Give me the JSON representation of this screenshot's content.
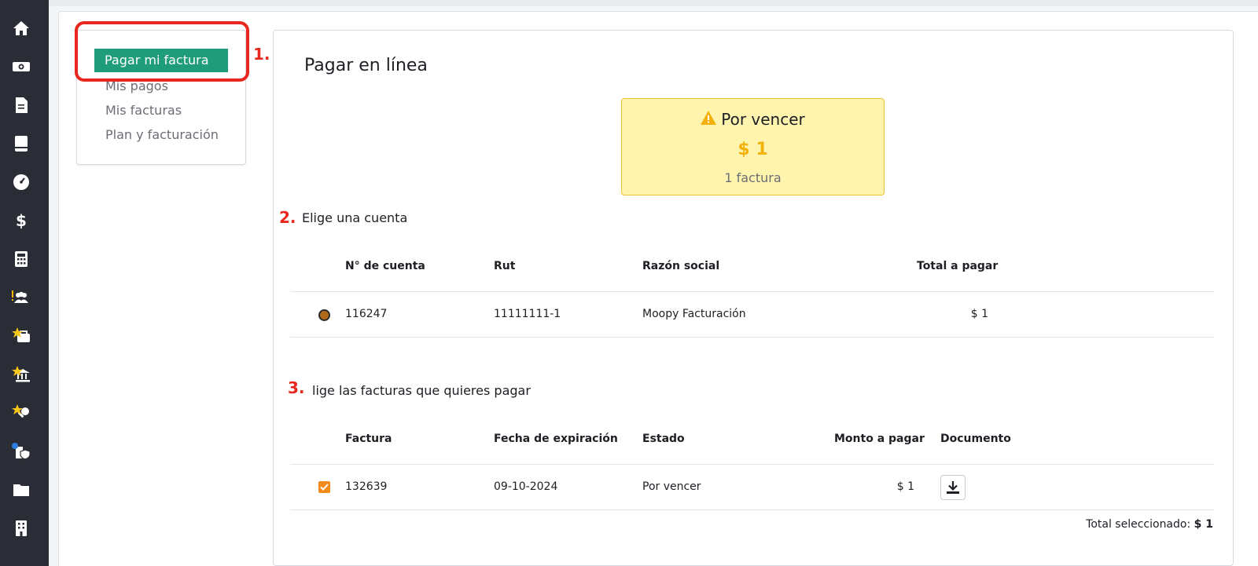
{
  "sidebar_icons": [
    "home-icon",
    "money-icon",
    "document-icon",
    "book-icon",
    "dashboard-icon",
    "dollar-icon",
    "calculator-icon",
    "users-alert-icon",
    "star-briefcase-icon",
    "star-bank-icon",
    "star-key-icon",
    "shield-building-icon",
    "folder-icon",
    "building-icon"
  ],
  "menu": {
    "active": "Pagar mi factura",
    "items": [
      "Mis pagos",
      "Mis facturas",
      "Plan y facturación"
    ]
  },
  "annotations": {
    "step1": "1.",
    "step2": "2.",
    "step3": "3."
  },
  "page_title": "Pagar en línea",
  "summary": {
    "status": "Por vencer",
    "amount": "$ 1",
    "count": "1 factura"
  },
  "accounts": {
    "title": "Elige una cuenta",
    "headers": [
      "N° de cuenta",
      "Rut",
      "Razón social",
      "Total a pagar"
    ],
    "rows": [
      {
        "account": "116247",
        "rut": "11111111-1",
        "name": "Moopy Facturación",
        "total": "$ 1",
        "selected": true
      }
    ]
  },
  "invoices": {
    "title": "lige las facturas que quieres pagar",
    "headers": [
      "Factura",
      "Fecha de expiración",
      "Estado",
      "Monto a pagar",
      "Documento"
    ],
    "rows": [
      {
        "invoice": "132639",
        "expiry": "09-10-2024",
        "status": "Por vencer",
        "amount": "$ 1",
        "checked": true
      }
    ]
  },
  "total_selected": {
    "label": "Total seleccionado:",
    "value": "$ 1"
  },
  "colors": {
    "sidebar": "#2a2d36",
    "accent_green": "#1f9d7a",
    "warning_bg": "#fff4ae",
    "warning_amount": "#f3b10a",
    "annotation_red": "#e8281e",
    "checkbox_orange": "#f38a1c"
  }
}
